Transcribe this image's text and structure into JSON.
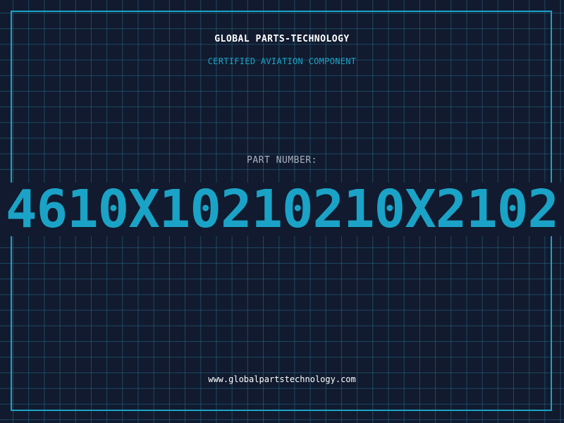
{
  "brand": {
    "title": "GLOBAL PARTS-TECHNOLOGY",
    "subtitle": "CERTIFIED AVIATION COMPONENT"
  },
  "part": {
    "label": "PART NUMBER:",
    "number": "4610X10210210X2102"
  },
  "footer": {
    "website": "www.globalpartstechnology.com"
  },
  "colors": {
    "background": "#111a2e",
    "accent": "#1aa3c6",
    "grid": "#286e8c",
    "title": "#ffffff",
    "label": "#a9b3c2"
  }
}
